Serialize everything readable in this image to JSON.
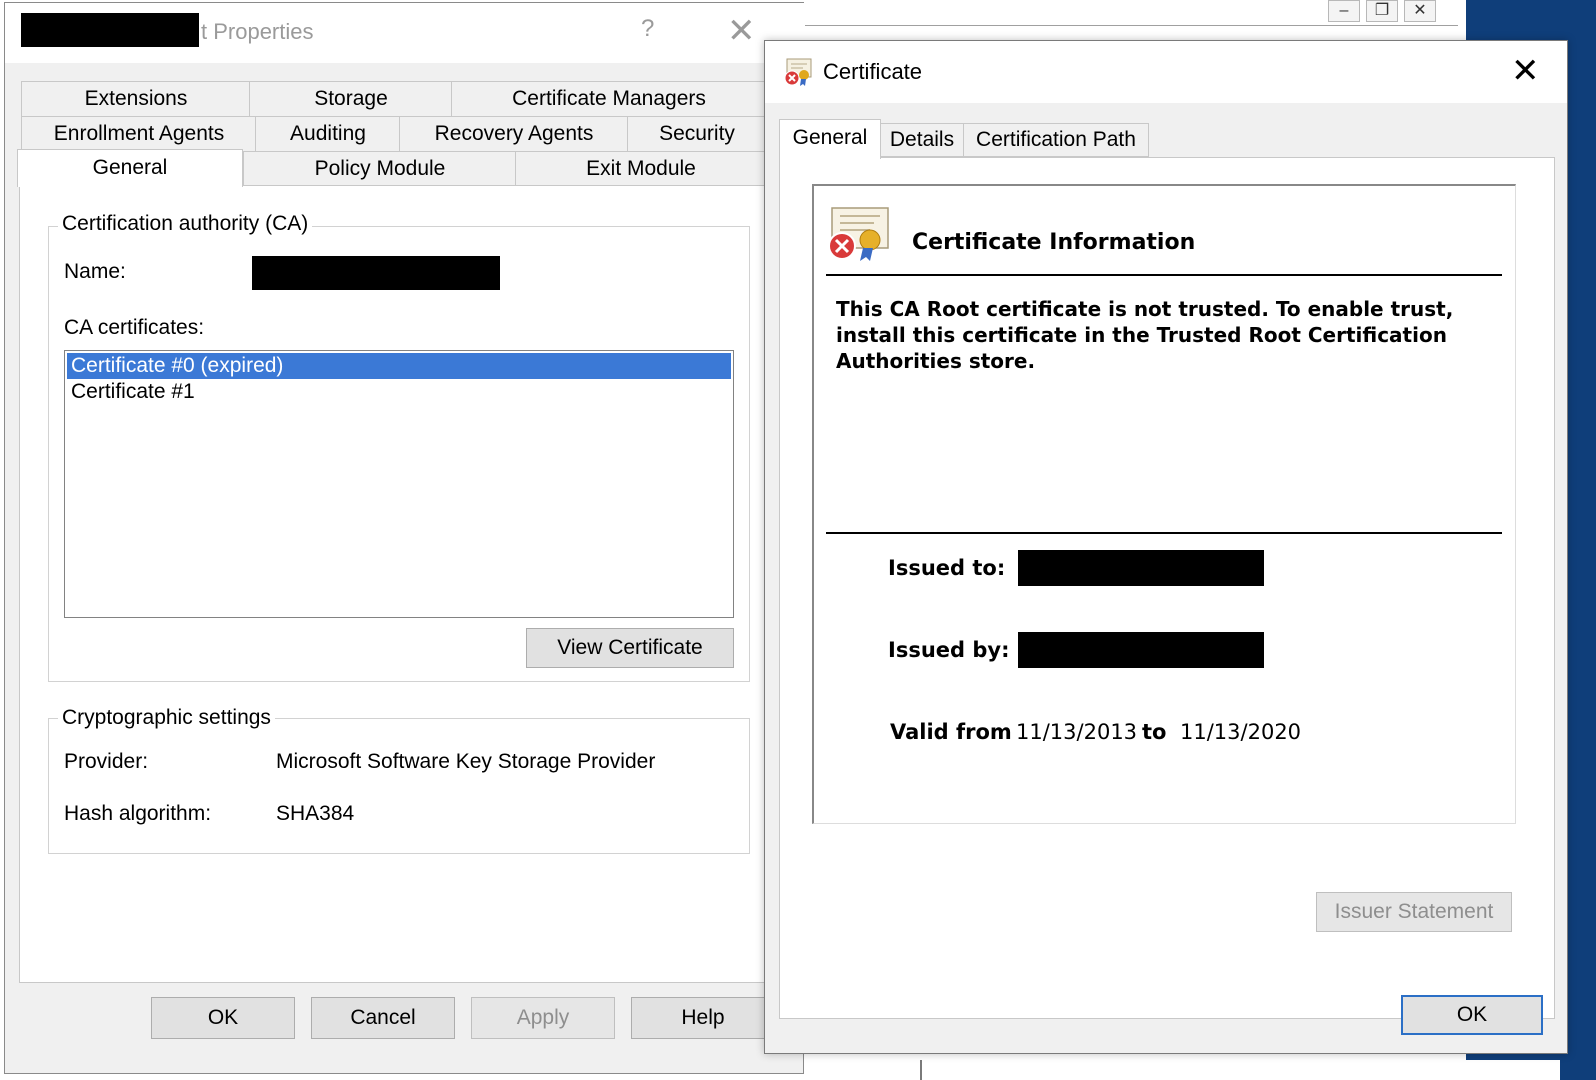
{
  "background": {
    "window_controls": [
      "–",
      "❐",
      "✕"
    ]
  },
  "properties_dialog": {
    "title_suffix": "t Properties",
    "help_glyph": "?",
    "close_glyph": "✕",
    "tabs_row1": [
      "Extensions",
      "Storage",
      "Certificate Managers"
    ],
    "tabs_row2": [
      "Enrollment Agents",
      "Auditing",
      "Recovery Agents",
      "Security"
    ],
    "tabs_row3": [
      "General",
      "Policy Module",
      "Exit Module"
    ],
    "active_tab": "General",
    "ca_group": {
      "legend": "Certification authority (CA)",
      "name_label": "Name:",
      "certs_label": "CA certificates:",
      "certificates": [
        "Certificate #0 (expired)",
        "Certificate #1"
      ],
      "selected_index": 0,
      "view_button": "View Certificate"
    },
    "crypto_group": {
      "legend": "Cryptographic settings",
      "provider_label": "Provider:",
      "provider_value": "Microsoft Software Key Storage Provider",
      "hash_label": "Hash algorithm:",
      "hash_value": "SHA384"
    },
    "buttons": {
      "ok": "OK",
      "cancel": "Cancel",
      "apply": "Apply",
      "help": "Help"
    }
  },
  "certificate_dialog": {
    "title": "Certificate",
    "close_glyph": "✕",
    "tabs": [
      "General",
      "Details",
      "Certification Path"
    ],
    "active_tab": "General",
    "info_heading": "Certificate Information",
    "warning_text": "This CA Root certificate is not trusted. To enable trust, install this certificate in the Trusted Root Certification Authorities store.",
    "issued_to_label": "Issued to:",
    "issued_by_label": "Issued by:",
    "valid_from_label": "Valid from",
    "valid_from": "11/13/2013",
    "to_label": "to",
    "valid_to": "11/13/2020",
    "issuer_statement_button": "Issuer Statement",
    "ok_button": "OK"
  },
  "colors": {
    "selection": "#3b79d6",
    "dialog_bg": "#f0f0f0",
    "default_button_border": "#2b6fc6",
    "desktop": "#0f3e7a"
  },
  "icons": [
    "certificate-error-icon",
    "certificate-ribbon-icon"
  ]
}
